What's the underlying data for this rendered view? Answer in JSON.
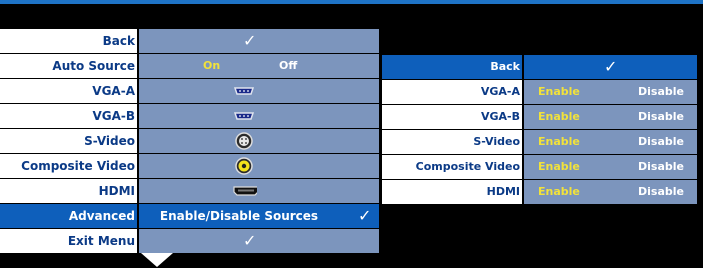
{
  "menu": {
    "items": [
      {
        "label": "Back",
        "value": "✓"
      },
      {
        "label": "Auto Source",
        "on": "On",
        "off": "Off"
      },
      {
        "label": "VGA-A",
        "icon": "vga-connector-icon"
      },
      {
        "label": "VGA-B",
        "icon": "vga-connector-icon"
      },
      {
        "label": "S-Video",
        "icon": "svideo-connector-icon"
      },
      {
        "label": "Composite Video",
        "icon": "composite-connector-icon"
      },
      {
        "label": "HDMI",
        "icon": "hdmi-connector-icon"
      },
      {
        "label": "Advanced",
        "value": "Enable/Disable Sources",
        "check": "✓"
      },
      {
        "label": "Exit Menu",
        "value": "✓"
      }
    ]
  },
  "panel": {
    "header": {
      "label": "Back",
      "check": "✓"
    },
    "rows": [
      {
        "label": "VGA-A",
        "enable": "Enable",
        "disable": "Disable"
      },
      {
        "label": "VGA-B",
        "enable": "Enable",
        "disable": "Disable"
      },
      {
        "label": "S-Video",
        "enable": "Enable",
        "disable": "Disable"
      },
      {
        "label": "Composite Video",
        "enable": "Enable",
        "disable": "Disable"
      },
      {
        "label": "HDMI",
        "enable": "Enable",
        "disable": "Disable"
      }
    ]
  },
  "colors": {
    "selected": "#0e5fbb",
    "value_bg": "#7c95bd",
    "label_text": "#0b3a86",
    "enable_text": "#f2e23a"
  }
}
